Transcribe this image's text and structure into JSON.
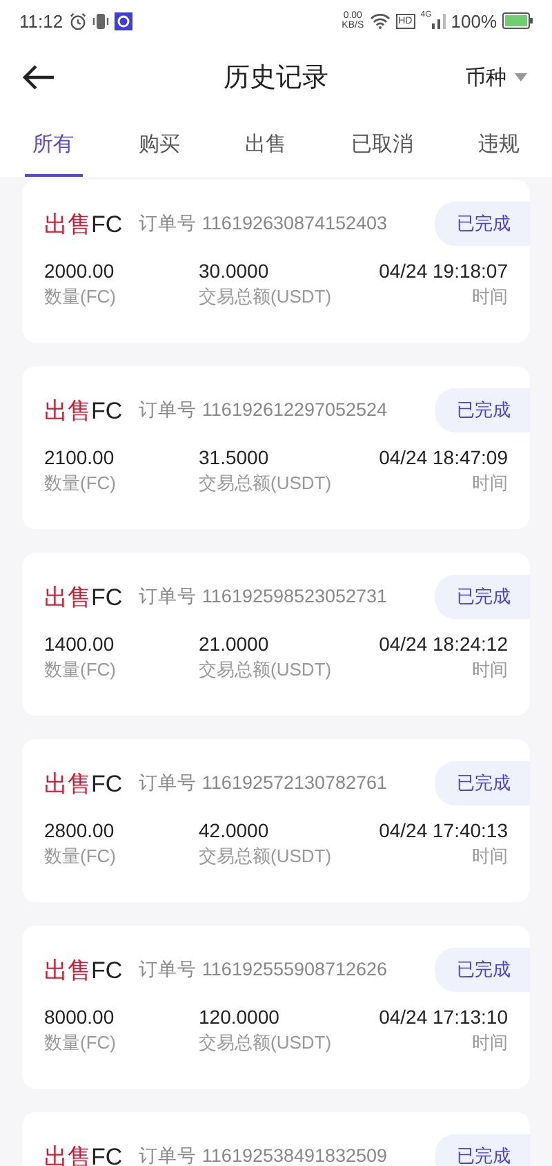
{
  "status_bar": {
    "time": "11:12",
    "speed": "0.00",
    "speed_unit": "KB/S",
    "hd": "HD",
    "network": "4G",
    "battery": "100%"
  },
  "header": {
    "title": "历史记录",
    "currency_filter": "币种"
  },
  "tabs": [
    {
      "label": "所有",
      "selected": true
    },
    {
      "label": "购买",
      "selected": false
    },
    {
      "label": "出售",
      "selected": false
    },
    {
      "label": "已取消",
      "selected": false
    },
    {
      "label": "违规",
      "selected": false
    }
  ],
  "orders": [
    {
      "side": "出售",
      "coin": "FC",
      "order_label": "订单号",
      "order_no": "116192630874152403",
      "status": "已完成",
      "amount": "2000.00",
      "amount_label": "数量(FC)",
      "total": "30.0000",
      "total_label": "交易总额(USDT)",
      "time": "04/24 19:18:07",
      "time_label": "时间"
    },
    {
      "side": "出售",
      "coin": "FC",
      "order_label": "订单号",
      "order_no": "116192612297052524",
      "status": "已完成",
      "amount": "2100.00",
      "amount_label": "数量(FC)",
      "total": "31.5000",
      "total_label": "交易总额(USDT)",
      "time": "04/24 18:47:09",
      "time_label": "时间"
    },
    {
      "side": "出售",
      "coin": "FC",
      "order_label": "订单号",
      "order_no": "116192598523052731",
      "status": "已完成",
      "amount": "1400.00",
      "amount_label": "数量(FC)",
      "total": "21.0000",
      "total_label": "交易总额(USDT)",
      "time": "04/24 18:24:12",
      "time_label": "时间"
    },
    {
      "side": "出售",
      "coin": "FC",
      "order_label": "订单号",
      "order_no": "116192572130782761",
      "status": "已完成",
      "amount": "2800.00",
      "amount_label": "数量(FC)",
      "total": "42.0000",
      "total_label": "交易总额(USDT)",
      "time": "04/24 17:40:13",
      "time_label": "时间"
    },
    {
      "side": "出售",
      "coin": "FC",
      "order_label": "订单号",
      "order_no": "116192555908712626",
      "status": "已完成",
      "amount": "8000.00",
      "amount_label": "数量(FC)",
      "total": "120.0000",
      "total_label": "交易总额(USDT)",
      "time": "04/24 17:13:10",
      "time_label": "时间"
    },
    {
      "side": "出售",
      "coin": "FC",
      "order_label": "订单号",
      "order_no": "116192538491832509",
      "status": "已完成"
    }
  ]
}
